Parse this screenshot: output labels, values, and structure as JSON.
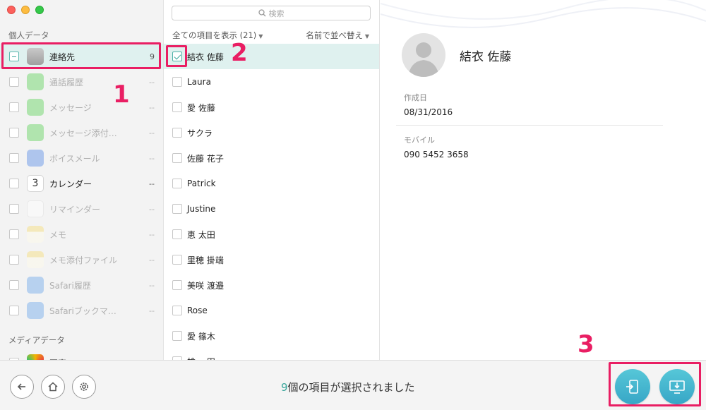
{
  "sidebar": {
    "section_personal": "個人データ",
    "section_media": "メディアデータ",
    "items": [
      {
        "label": "連絡先",
        "count": "9",
        "icon": "contacts-icon",
        "state": "partial",
        "selected": true,
        "enabled": true
      },
      {
        "label": "通話履歴",
        "count": "--",
        "icon": "phone-icon",
        "state": "unchecked",
        "enabled": false
      },
      {
        "label": "メッセージ",
        "count": "--",
        "icon": "message-icon",
        "state": "unchecked",
        "enabled": false
      },
      {
        "label": "メッセージ添付…",
        "count": "--",
        "icon": "message-attachment-icon",
        "state": "unchecked",
        "enabled": false
      },
      {
        "label": "ボイスメール",
        "count": "--",
        "icon": "voicemail-icon",
        "state": "unchecked",
        "enabled": false
      },
      {
        "label": "カレンダー",
        "count": "--",
        "icon": "calendar-icon",
        "state": "unchecked",
        "enabled": true
      },
      {
        "label": "リマインダー",
        "count": "--",
        "icon": "reminder-icon",
        "state": "unchecked",
        "enabled": false
      },
      {
        "label": "メモ",
        "count": "--",
        "icon": "memo-icon",
        "state": "unchecked",
        "enabled": false
      },
      {
        "label": "メモ添付ファイル",
        "count": "--",
        "icon": "memo-attachment-icon",
        "state": "unchecked",
        "enabled": false
      },
      {
        "label": "Safari履歴",
        "count": "--",
        "icon": "safari-history-icon",
        "state": "unchecked",
        "enabled": false
      },
      {
        "label": "Safariブックマ…",
        "count": "--",
        "icon": "safari-bookmark-icon",
        "state": "unchecked",
        "enabled": false
      },
      {
        "label": "写真",
        "count": "",
        "icon": "photos-icon",
        "state": "unchecked",
        "enabled": true
      }
    ],
    "calendar_day": "3"
  },
  "list": {
    "search_placeholder": "検索",
    "filter_label": "全ての項目を表示 (21)",
    "sort_label": "名前で並べ替え",
    "rows": [
      {
        "name": "結衣 佐藤",
        "checked": true,
        "selected": true
      },
      {
        "name": "Laura",
        "checked": false
      },
      {
        "name": "愛 佐藤",
        "checked": false
      },
      {
        "name": "サクラ",
        "checked": false
      },
      {
        "name": "佐藤 花子",
        "checked": false
      },
      {
        "name": "Patrick",
        "checked": false
      },
      {
        "name": "Justine",
        "checked": false
      },
      {
        "name": "恵 太田",
        "checked": false
      },
      {
        "name": "里穂 掛端",
        "checked": false
      },
      {
        "name": "美咲 渡邉",
        "checked": false
      },
      {
        "name": "Rose",
        "checked": false
      },
      {
        "name": "愛 篠木",
        "checked": false
      },
      {
        "name": "雄一 田",
        "checked": false
      }
    ]
  },
  "detail": {
    "name": "結衣 佐藤",
    "created_label": "作成日",
    "created_value": "08/31/2016",
    "mobile_label": "モバイル",
    "mobile_value": "090 5452 3658"
  },
  "footer": {
    "selected_count": "9",
    "selected_text": "個の項目が選択されました"
  },
  "annotations": {
    "step1": "1",
    "step2": "2",
    "step3": "3"
  },
  "colors": {
    "accent": "#3aa69b",
    "selection_bg": "#dff1ef",
    "highlight": "#e91e63"
  }
}
